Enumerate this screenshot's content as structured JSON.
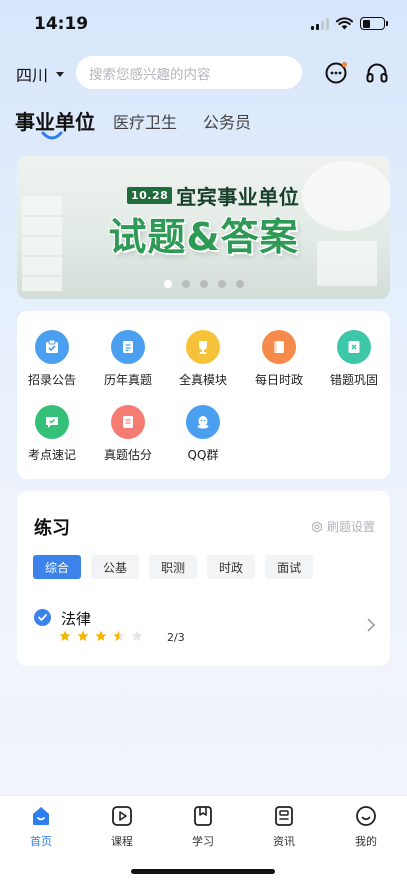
{
  "status_bar": {
    "time": "14:19"
  },
  "header": {
    "region": "四川",
    "search_placeholder": "搜索您感兴趣的内容",
    "icons": [
      "chat-icon",
      "headset-icon"
    ]
  },
  "category_tabs": [
    {
      "label": "事业单位",
      "active": true
    },
    {
      "label": "医疗卫生",
      "active": false
    },
    {
      "label": "公务员",
      "active": false
    }
  ],
  "banner": {
    "date_badge": "10.28",
    "line1": "宜宾事业单位",
    "line2": "试题&答案",
    "slide_count": 5,
    "active_slide": 1
  },
  "menu": [
    {
      "label": "招录公告",
      "icon": "announcement-icon",
      "color": "#4a9ff0"
    },
    {
      "label": "历年真题",
      "icon": "scroll-icon",
      "color": "#4a9ff0"
    },
    {
      "label": "全真模块",
      "icon": "trophy-icon",
      "color": "#f6c23a"
    },
    {
      "label": "每日时政",
      "icon": "book-icon",
      "color": "#f58a4b"
    },
    {
      "label": "错题巩固",
      "icon": "error-note-icon",
      "color": "#3ec6a8"
    },
    {
      "label": "考点速记",
      "icon": "memo-chat-icon",
      "color": "#35c07a"
    },
    {
      "label": "真题估分",
      "icon": "score-icon",
      "color": "#f47c72"
    },
    {
      "label": "QQ群",
      "icon": "qq-icon",
      "color": "#4a9ff0"
    }
  ],
  "practice": {
    "title": "练习",
    "settings_label": "刷题设置",
    "filters": [
      {
        "label": "综合",
        "active": true
      },
      {
        "label": "公基",
        "active": false
      },
      {
        "label": "职测",
        "active": false
      },
      {
        "label": "时政",
        "active": false
      },
      {
        "label": "面试",
        "active": false
      }
    ],
    "subject": {
      "name": "法律",
      "rating": 3.5,
      "max_rating": 5,
      "progress": "2/3"
    }
  },
  "bottom_nav": [
    {
      "label": "首页",
      "icon": "home-icon",
      "active": true
    },
    {
      "label": "课程",
      "icon": "play-icon",
      "active": false
    },
    {
      "label": "学习",
      "icon": "bookmark-icon",
      "active": false
    },
    {
      "label": "资讯",
      "icon": "news-icon",
      "active": false
    },
    {
      "label": "我的",
      "icon": "profile-icon",
      "active": false
    }
  ],
  "colors": {
    "accent": "#2f7ef0",
    "chip_active": "#3b82ea",
    "star": "#f5b400",
    "notification_dot": "#f5893b"
  }
}
